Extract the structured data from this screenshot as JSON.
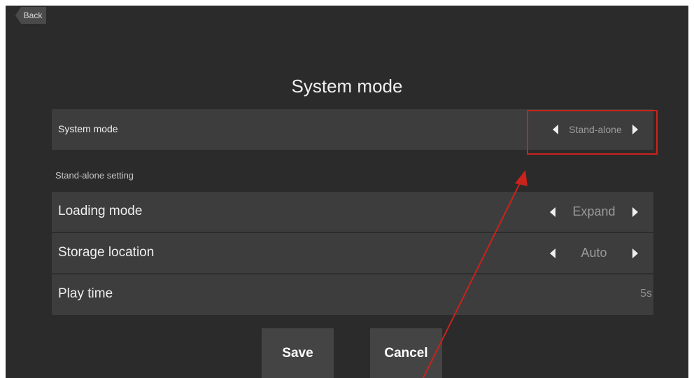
{
  "header": {
    "back_label": "Back"
  },
  "page": {
    "title": "System mode"
  },
  "system_mode": {
    "label": "System mode",
    "value": "Stand-alone",
    "prev_icon": "left-triangle-icon",
    "next_icon": "right-triangle-icon"
  },
  "standalone": {
    "section_label": "Stand-alone setting",
    "loading_mode": {
      "label": "Loading mode",
      "value": "Expand"
    },
    "storage_location": {
      "label": "Storage location",
      "value": "Auto"
    },
    "play_time": {
      "label": "Play time",
      "value": "5s"
    }
  },
  "actions": {
    "save_label": "Save",
    "cancel_label": "Cancel"
  },
  "colors": {
    "background": "#2b2b2b",
    "row": "#3d3d3d",
    "button": "#444444",
    "annotation": "#c9231c"
  }
}
